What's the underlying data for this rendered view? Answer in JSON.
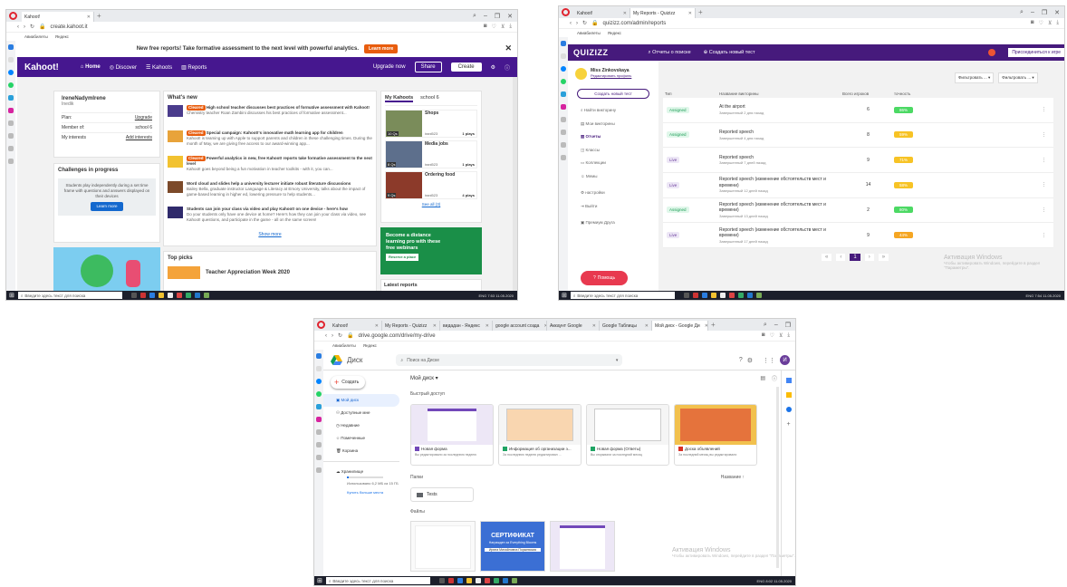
{
  "shot1": {
    "tabs": [
      {
        "label": "Kahoot!"
      }
    ],
    "url": "create.kahoot.it",
    "bookmarks": [
      "Авиабилеты",
      "Яндекс"
    ],
    "banner": {
      "text": "New free reports! Take formative assessment to the next level with powerful analytics.",
      "cta": "Learn more"
    },
    "nav": {
      "logo": "Kahoot!",
      "home": "Home",
      "discover": "Discover",
      "kahoots": "Kahoots",
      "reports": "Reports",
      "upgrade": "Upgrade now",
      "share": "Share",
      "create": "Create"
    },
    "profile": {
      "name": "IreneNadymIrene",
      "subtitle": "Inedik",
      "plan_label": "Plan:",
      "plan_value": "Upgrade",
      "member_label": "Member of:",
      "member_value": "school 6",
      "interests_label": "My interests",
      "interests_value": "Add interests"
    },
    "challenges": {
      "title": "Challenges in progress",
      "text": "Students play independently during a set time frame with questions and answers displayed on their devices",
      "button": "Learn more"
    },
    "whats_new": {
      "title": "What's new",
      "items": [
        {
          "badge": "Cleared",
          "title": "High school teacher discusses best practices of formative assessment with Kahoot!",
          "text": "Chemistry teacher Roan Zambini discusses his best practices of formative assessment..."
        },
        {
          "badge": "Cleared",
          "title": "Special campaign: Kahoot!'s innovative math learning app for children",
          "text": "Kahoot! is teaming up with Apple to support parents and children in these challenging times. During the month of May, we are giving free access to our award-winning app..."
        },
        {
          "badge": "Cleared",
          "title": "Powerful analytics in new, free Kahoot! reports take formative assessment to the next level",
          "text": "Kahoot! goes beyond being a fun motivation in teacher toolkits - with it, you can..."
        },
        {
          "badge": "",
          "title": "Word cloud and slides help a university lecturer initiate robust literature discussions",
          "text": "Bailey Bella, graduate instructor Language & Literacy at Emory University, talks about the impact of game-based learning in higher ed, lowering pressure to help students..."
        },
        {
          "badge": "",
          "title": "Students can join your class via video and play Kahoot! on one device - here's how",
          "text": "Do your students only have one device at home? Here's how they can join your class via video, see Kahoot! questions, and participate in the game - all on the same screen!"
        }
      ],
      "show_more": "Show more"
    },
    "top_picks": {
      "title": "Top picks",
      "item": "Teacher Appreciation Week 2020"
    },
    "my_kahoots": {
      "tab_mine": "My Kahoots",
      "tab_school": "school 6",
      "items": [
        {
          "title": "Shops",
          "meta": "10 Qs",
          "author": "irani523",
          "plays": "1 plays"
        },
        {
          "title": "Media jobs",
          "meta": "8 Qs",
          "author": "irani523",
          "plays": "1 plays"
        },
        {
          "title": "Ordering food",
          "meta": "9 Qs",
          "author": "irani523",
          "plays": "4 plays"
        }
      ],
      "see_all": "See all (3)"
    },
    "promo": {
      "text": "Become a distance learning pro with these free webinars",
      "button": "Reserve a place"
    },
    "latest_reports": "Latest reports",
    "taskbar": {
      "search": "Введите здесь текст для поиска",
      "lang": "ENG",
      "time": "7:53",
      "date": "11.05.2020"
    }
  },
  "shot2": {
    "tabs": [
      {
        "label": "Kahoot!"
      },
      {
        "label": "My Reports - Quizizz"
      }
    ],
    "url": "quizizz.com/admin/reports",
    "bookmarks": [
      "Авиабилеты",
      "Яндекс"
    ],
    "header": {
      "logo": "QUIZIZZ",
      "search": "Отчеты о поиске",
      "create": "Создать новый тест",
      "join": "Присоединиться к игре"
    },
    "user": {
      "name": "Miss Zinkovskaya",
      "edit": "Редактировать профиль"
    },
    "sidebar": {
      "create_button": "Создать новый тест",
      "items": [
        "Найти викторину",
        "Мои викторины",
        "Отчеты",
        "Классы",
        "Коллекции",
        "Мемы",
        "настройки",
        "Выйти",
        "Премиум Друга"
      ]
    },
    "filters": [
      "Фильтровать ...",
      "Фильтровать ..."
    ],
    "columns": [
      "Тип",
      "Название викторины",
      "Всего игроков",
      "точность"
    ],
    "rows": [
      {
        "type": "Assigned",
        "title": "At the airport",
        "sub": "Завершенный 2 дня назад",
        "players": "6",
        "acc": "86%",
        "acc_color": "#4cd964"
      },
      {
        "type": "Assigned",
        "title": "Reported speech",
        "sub": "Завершенный 4 дня назад",
        "players": "8",
        "acc": "59%",
        "acc_color": "#f7c325"
      },
      {
        "type": "Live",
        "title": "Reported speech",
        "sub": "Завершенный 7 дней назад",
        "players": "9",
        "acc": "71%",
        "acc_color": "#f7c325"
      },
      {
        "type": "Live",
        "title": "Reported speech (изменение обстоятельств мест и времени)",
        "sub": "Завершенный 12 дней назад",
        "players": "14",
        "acc": "58%",
        "acc_color": "#f7c325"
      },
      {
        "type": "Assigned",
        "title": "Reported speech (изменение обстоятельств мест и времени)",
        "sub": "Завершенный 13 дней назад",
        "players": "2",
        "acc": "80%",
        "acc_color": "#4cd964"
      },
      {
        "type": "Live",
        "title": "Reported speech (изменение обстоятельств мест и времени)",
        "sub": "Завершенный 17 дней назад",
        "players": "9",
        "acc": "44%",
        "acc_color": "#f5a623"
      }
    ],
    "page": "1",
    "help": "Помощь",
    "watermark": {
      "title": "Активация Windows",
      "sub": "Чтобы активировать Windows, перейдите в раздел \"Параметры\"."
    },
    "taskbar": {
      "search": "Введите здесь текст для поиска",
      "lang": "ENG",
      "time": "7:54",
      "date": "11.05.2020"
    }
  },
  "shot3": {
    "tabs": [
      {
        "label": "Kahoot!"
      },
      {
        "label": "My Reports - Quizizz"
      },
      {
        "label": "видадан - Яндекс"
      },
      {
        "label": "google account созда"
      },
      {
        "label": "Аккаунт Google"
      },
      {
        "label": "Google Таблицы"
      },
      {
        "label": "Мой диск - Google Ди"
      }
    ],
    "url": "drive.google.com/drive/my-drive",
    "bookmarks": [
      "Авиабилеты",
      "Яндекс"
    ],
    "app_title": "Диск",
    "search_placeholder": "Поиск на Диске",
    "avatar_letter": "И",
    "create_button": "Создать",
    "nav": [
      "Мой диск",
      "Доступные мне",
      "Недавние",
      "Помеченные",
      "Корзина"
    ],
    "storage": {
      "label": "Хранилище",
      "used": "Использовано 6,2 МБ из 15 ГБ",
      "buy": "Купить больше места"
    },
    "breadcrumb": "Мой диск",
    "quick_access": "Быстрый доступ",
    "quick_files": [
      {
        "name": "Новая форма",
        "sub": "Вы редактировали за последнюю неделю",
        "icon_color": "#7248b9"
      },
      {
        "name": "Информация об организации э...",
        "sub": "За последнюю неделю редактировал ...",
        "icon_color": "#1fa463"
      },
      {
        "name": "Новая форма (Ответы)",
        "sub": "Вы открывали за последний месяц",
        "icon_color": "#1fa463"
      },
      {
        "name": "Доска объявлений",
        "sub": "За последний месяц вы редактировали",
        "icon_color": "#d93025"
      }
    ],
    "folders_label": "Папки",
    "sort_label": "Название",
    "folder": "Tests",
    "files_label": "Файлы",
    "cert_title": "СЕРТИФИКАТ",
    "cert_sub": "Награжден за Everything Blooms",
    "cert_name": "Ирина Михайловна Поржевская",
    "watermark": {
      "title": "Активация Windows",
      "sub": "Чтобы активировать Windows, перейдите в раздел \"Параметры\"."
    },
    "taskbar": {
      "search": "Введите здесь текст для поиска",
      "lang": "ENG",
      "time": "8:02",
      "date": "11.05.2020"
    }
  },
  "colors": {
    "kahoot_purple": "#46178f",
    "quizizz_purple": "#461a7c",
    "drive_blue": "#1a73e8",
    "opera_red": "#e0242f"
  }
}
